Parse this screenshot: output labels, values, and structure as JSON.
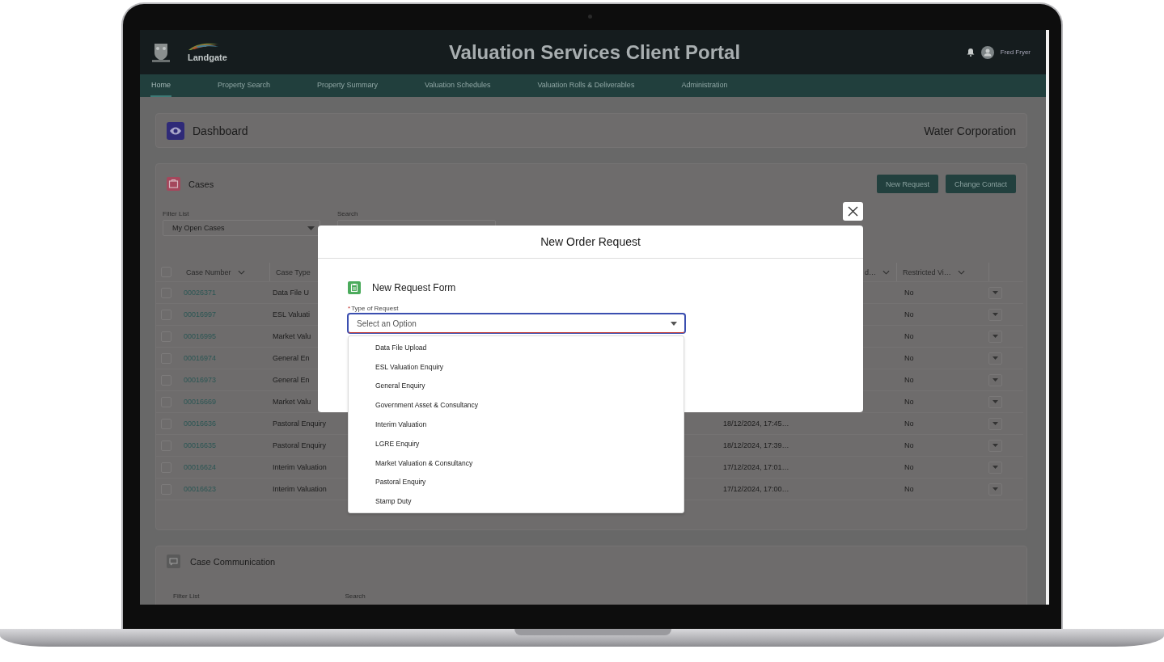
{
  "header": {
    "logo_text": "Landgate",
    "title": "Valuation Services Client Portal",
    "user": "Fred Fryer"
  },
  "nav": [
    {
      "label": "Home",
      "selected": true
    },
    {
      "label": "Property Search",
      "selected": false
    },
    {
      "label": "Property Summary",
      "selected": false
    },
    {
      "label": "Valuation Schedules",
      "selected": false
    },
    {
      "label": "Valuation Rolls & Deliverables",
      "selected": false
    },
    {
      "label": "Administration",
      "selected": false
    }
  ],
  "dashboard": {
    "title": "Dashboard",
    "organisation": "Water Corporation"
  },
  "cases": {
    "title": "Cases",
    "buttons": [
      "New Request",
      "Change Contact"
    ],
    "filter": {
      "label": "Filter List",
      "value": "My Open Cases"
    },
    "search": {
      "label": "Search"
    },
    "table": {
      "select_all_checked": false,
      "columns": [
        "Case Number",
        "Case Type",
        "d…",
        "Restricted Vi…"
      ],
      "rows": [
        {
          "case_number": "00026371",
          "case_type": "Data File U",
          "restricted": "No",
          "checked": false
        },
        {
          "case_number": "00016997",
          "case_type": "ESL Valuati",
          "restricted": "No",
          "checked": false
        },
        {
          "case_number": "00016995",
          "case_type": "Market Valu",
          "restricted": "No",
          "checked": false
        },
        {
          "case_number": "00016974",
          "case_type": "General En",
          "restricted": "No",
          "checked": false
        },
        {
          "case_number": "00016973",
          "case_type": "General En",
          "restricted": "No",
          "checked": false
        },
        {
          "case_number": "00016669",
          "case_type": "Market Valu",
          "restricted": "No",
          "checked": false
        },
        {
          "case_number": "00016636",
          "case_type": "Pastoral Enquiry",
          "date": "18/12/2024, 17:45…",
          "restricted": "No",
          "checked": false
        },
        {
          "case_number": "00016635",
          "case_type": "Pastoral Enquiry",
          "date": "18/12/2024, 17:39…",
          "restricted": "No",
          "checked": false
        },
        {
          "case_number": "00016624",
          "case_type": "Interim Valuation",
          "date": "17/12/2024, 17:01…",
          "restricted": "No",
          "checked": false
        },
        {
          "case_number": "00016623",
          "case_type": "Interim Valuation",
          "date": "17/12/2024, 17:00…",
          "restricted": "No",
          "checked": false
        }
      ]
    }
  },
  "communication": {
    "title": "Case Communication",
    "filter_label": "Filter List",
    "search_label": "Search"
  },
  "modal": {
    "title": "New Order Request",
    "section": "New Request Form",
    "field": {
      "required_mark": "*",
      "label": "Type of Request",
      "placeholder": "Select an Option",
      "options": [
        "Data File Upload",
        "ESL Valuation Enquiry",
        "General Enquiry",
        "Government Asset & Consultancy",
        "Interim Valuation",
        "LGRE Enquiry",
        "Market Valuation & Consultancy",
        "Pastoral Enquiry",
        "Stamp Duty"
      ]
    }
  }
}
